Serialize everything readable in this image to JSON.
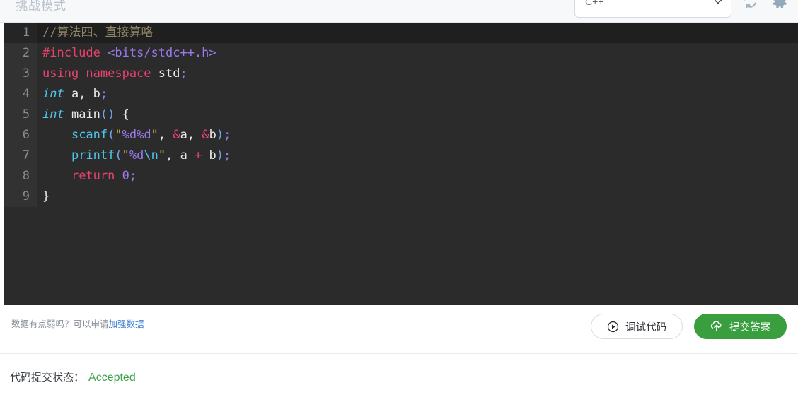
{
  "topbar": {
    "mode_label": "挑战模式",
    "language_select": {
      "value": "C++",
      "icon": "chevron-down-icon"
    },
    "refresh_icon": "refresh-icon",
    "settings_icon": "gear-icon"
  },
  "editor": {
    "language": "C++",
    "active_line": 1,
    "lines": [
      {
        "num": "1"
      },
      {
        "num": "2"
      },
      {
        "num": "3"
      },
      {
        "num": "4"
      },
      {
        "num": "5"
      },
      {
        "num": "6"
      },
      {
        "num": "7"
      },
      {
        "num": "8"
      },
      {
        "num": "9"
      }
    ],
    "code_tokens": {
      "l1_comment": "//",
      "l1_text": "算法四、直接算咯",
      "l2_preproc": "#include",
      "l2_include": " <bits/stdc++.h>",
      "l3_using": "using",
      "l3_namespace": " namespace",
      "l3_std": " std",
      "l3_semi": ";",
      "l4_int": "int",
      "l4_rest": " a, b",
      "l4_semi": ";",
      "l5_int": "int",
      "l5_main": " main",
      "l5_paren": "()",
      "l5_brace": " {",
      "l6_indent": "    ",
      "l6_fn": "scanf",
      "l6_open": "(",
      "l6_q1": "\"",
      "l6_str": "%d%d",
      "l6_q2": "\"",
      "l6_comma": ", ",
      "l6_amp1": "&",
      "l6_a": "a",
      "l6_comma2": ", ",
      "l6_amp2": "&",
      "l6_b": "b",
      "l6_close": ")",
      "l6_semi": ";",
      "l7_indent": "    ",
      "l7_fn": "printf",
      "l7_open": "(",
      "l7_q1": "\"",
      "l7_str": "%d",
      "l7_esc": "\\n",
      "l7_q2": "\"",
      "l7_comma": ", ",
      "l7_a": "a ",
      "l7_op": "+",
      "l7_b": " b",
      "l7_close": ")",
      "l7_semi": ";",
      "l8_indent": "    ",
      "l8_return": "return",
      "l8_num": " 0",
      "l8_semi": ";",
      "l9_brace": "}"
    },
    "full_code": "//算法四、直接算咯\n#include <bits/stdc++.h>\nusing namespace std;\nint a, b;\nint main() {\n    scanf(\"%d%d\", &a, &b);\n    printf(\"%d\\n\", a + b);\n    return 0;\n}"
  },
  "actions": {
    "weak_data_prefix": "数据有点弱吗？可以申请",
    "weak_data_link": "加强数据",
    "debug_label": "调试代码",
    "debug_icon": "play-circle-icon",
    "submit_label": "提交答案",
    "submit_icon": "upload-icon"
  },
  "status": {
    "label": "代码提交状态：",
    "value": "Accepted"
  },
  "colors": {
    "submit_green": "#389e3e",
    "accepted_green": "#3fa34d",
    "link_blue": "#3c7fd0",
    "editor_bg": "#2b2b2b"
  }
}
